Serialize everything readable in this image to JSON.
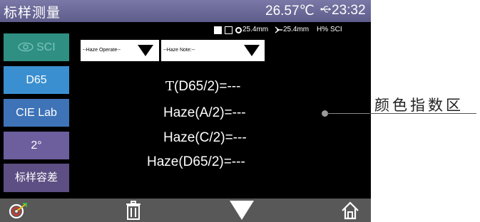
{
  "header": {
    "app_title": "标样测量",
    "temperature": "26.57℃",
    "clock": "23:32"
  },
  "status": {
    "aperture_1": "25.4mm",
    "aperture_2": "25.4mm",
    "mode_h": "H%",
    "mode_sci": "SCI"
  },
  "sidebar": {
    "items": [
      {
        "label": "SCI"
      },
      {
        "label": "D65"
      },
      {
        "label": "CIE Lab"
      },
      {
        "label": "2°"
      },
      {
        "label": "标样容差"
      }
    ]
  },
  "dropdowns": {
    "operate": "--Haze Operate--",
    "note": "--Haze Note:--"
  },
  "readings": {
    "r1_prefix": "T",
    "r1_rest": "(D65/2)=---",
    "r2": "Haze(A/2)=---",
    "r3": "Haze(C/2)=---",
    "r4": "Haze(D65/2)=---"
  },
  "annotation": {
    "label": "颜色指数区"
  },
  "colors": {
    "titlebar": "#6c6a98",
    "screen_bg": "#000000",
    "bottom_bar": "#585858",
    "sci_button": "#2f8f82",
    "d65_button": "#3a8fd0",
    "cie_button": "#3e73b8",
    "angle_button": "#6d5e9e",
    "tolerance_button": "#5d4f83"
  },
  "icons": {
    "usb": "usb-icon",
    "eye": "eye-icon",
    "target": "target-icon",
    "trash": "trash-icon",
    "down": "triangle-down-icon",
    "home": "home-icon"
  }
}
